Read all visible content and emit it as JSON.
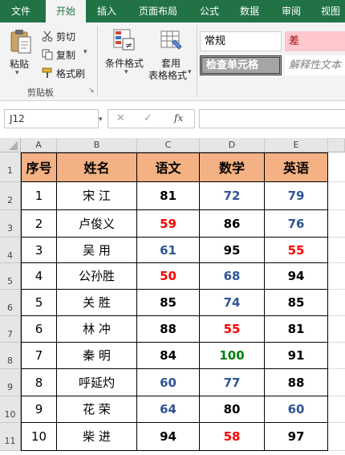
{
  "ribbon_tabs": [
    "文件",
    "开始",
    "插入",
    "页面布局",
    "公式",
    "数据",
    "审阅",
    "视图"
  ],
  "clipboard": {
    "paste": "粘贴",
    "cut": "剪切",
    "copy": "复制",
    "format_painter": "格式刷",
    "group_label": "剪贴板"
  },
  "styles_group": {
    "conditional_format": "条件格式",
    "table_format_line1": "套用",
    "table_format_line2": "表格格式"
  },
  "cell_styles": {
    "normal": "常规",
    "bad": "差",
    "check_cell": "检查单元格",
    "explanatory": "解释性文本"
  },
  "formula_bar": {
    "name_box": "J12",
    "cancel": "✕",
    "confirm": "✓",
    "fx": "fx",
    "formula": ""
  },
  "columns": [
    "A",
    "B",
    "C",
    "D",
    "E"
  ],
  "rows": [
    "1",
    "2",
    "3",
    "4",
    "5",
    "6",
    "7",
    "8",
    "9",
    "10",
    "11"
  ],
  "table": {
    "headers": [
      "序号",
      "姓名",
      "语文",
      "数学",
      "英语"
    ],
    "records": [
      [
        "1",
        "宋  江",
        "81",
        "72",
        "79"
      ],
      [
        "2",
        "卢俊义",
        "59",
        "86",
        "76"
      ],
      [
        "3",
        "吴  用",
        "61",
        "95",
        "55"
      ],
      [
        "4",
        "公孙胜",
        "50",
        "68",
        "94"
      ],
      [
        "5",
        "关  胜",
        "85",
        "74",
        "85"
      ],
      [
        "6",
        "林  冲",
        "88",
        "55",
        "81"
      ],
      [
        "7",
        "秦  明",
        "84",
        "100",
        "91"
      ],
      [
        "8",
        "呼延灼",
        "60",
        "77",
        "88"
      ],
      [
        "9",
        "花  荣",
        "64",
        "80",
        "60"
      ],
      [
        "10",
        "柴  进",
        "94",
        "58",
        "97"
      ]
    ],
    "score_colors": {
      "below_60": "#ff0000",
      "60_to_79": "#2f5597",
      "80_to_99": "#000000",
      "100": "#00800f"
    },
    "header_fill": "#f4b183"
  }
}
